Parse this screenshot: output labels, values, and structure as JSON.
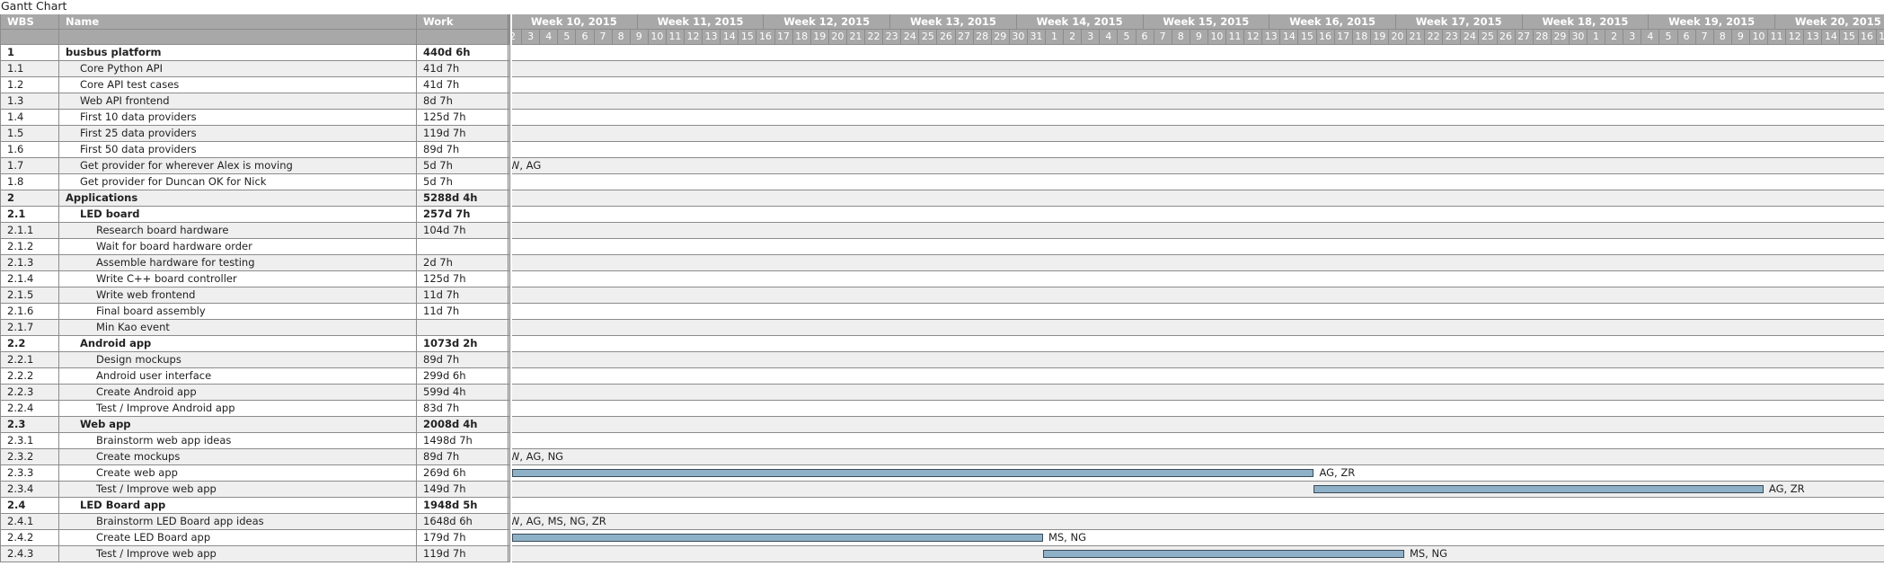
{
  "title": "Gantt Chart",
  "columns": {
    "wbs": "WBS",
    "name": "Name",
    "work": "Work"
  },
  "weeks": [
    "Week 10, 2015",
    "Week 11, 2015",
    "Week 12, 2015",
    "Week 13, 2015",
    "Week 14, 2015",
    "Week 15, 2015",
    "Week 16, 2015",
    "Week 17, 2015",
    "Week 18, 2015",
    "Week 19, 2015",
    "Week 20, 2015"
  ],
  "days": [
    "2",
    "3",
    "4",
    "5",
    "6",
    "7",
    "8",
    "9",
    "10",
    "11",
    "12",
    "13",
    "14",
    "15",
    "16",
    "17",
    "18",
    "19",
    "20",
    "21",
    "22",
    "23",
    "24",
    "25",
    "26",
    "27",
    "28",
    "29",
    "30",
    "31",
    "1",
    "2",
    "3",
    "4",
    "5",
    "6",
    "7",
    "8",
    "9",
    "10",
    "11",
    "12",
    "13",
    "14",
    "15",
    "16",
    "17",
    "18",
    "19",
    "20",
    "21",
    "22",
    "23",
    "24",
    "25",
    "26",
    "27",
    "28",
    "29",
    "30",
    "1",
    "2",
    "3",
    "4",
    "5",
    "6",
    "7",
    "8",
    "9",
    "10",
    "11",
    "12",
    "13",
    "14",
    "15",
    "16",
    "17"
  ],
  "colors": {
    "header": "#a8a8a8",
    "bar": "#8fb1c8",
    "bar_border": "#3b4b58",
    "alt_row": "#efefef"
  },
  "tasks": [
    {
      "wbs": "1",
      "name": "busbus platform",
      "work": "440d 6h",
      "level": 0,
      "bold": true
    },
    {
      "wbs": "1.1",
      "name": "Core Python API",
      "work": "41d 7h",
      "level": 1
    },
    {
      "wbs": "1.2",
      "name": "Core API test cases",
      "work": "41d 7h",
      "level": 1
    },
    {
      "wbs": "1.3",
      "name": "Web API frontend",
      "work": "8d 7h",
      "level": 1
    },
    {
      "wbs": "1.4",
      "name": "First 10 data providers",
      "work": "125d 7h",
      "level": 1
    },
    {
      "wbs": "1.5",
      "name": "First 25 data providers",
      "work": "119d 7h",
      "level": 1
    },
    {
      "wbs": "1.6",
      "name": "First 50 data providers",
      "work": "89d 7h",
      "level": 1
    },
    {
      "wbs": "1.7",
      "name": "Get provider for wherever Alex is moving",
      "work": "5d 7h",
      "level": 1,
      "resources": "W, AG"
    },
    {
      "wbs": "1.8",
      "name": "Get provider for Duncan OK for Nick",
      "work": "5d 7h",
      "level": 1
    },
    {
      "wbs": "2",
      "name": "Applications",
      "work": "5288d 4h",
      "level": 0,
      "bold": true
    },
    {
      "wbs": "2.1",
      "name": "LED board",
      "work": "257d 7h",
      "level": 1,
      "bold": true
    },
    {
      "wbs": "2.1.1",
      "name": "Research board hardware",
      "work": "104d 7h",
      "level": 2
    },
    {
      "wbs": "2.1.2",
      "name": "Wait for board hardware order",
      "work": "",
      "level": 2
    },
    {
      "wbs": "2.1.3",
      "name": "Assemble hardware for testing",
      "work": "2d 7h",
      "level": 2
    },
    {
      "wbs": "2.1.4",
      "name": "Write C++ board controller",
      "work": "125d 7h",
      "level": 2
    },
    {
      "wbs": "2.1.5",
      "name": "Write web frontend",
      "work": "11d 7h",
      "level": 2
    },
    {
      "wbs": "2.1.6",
      "name": "Final board assembly",
      "work": "11d 7h",
      "level": 2
    },
    {
      "wbs": "2.1.7",
      "name": "Min Kao event",
      "work": "",
      "level": 2
    },
    {
      "wbs": "2.2",
      "name": "Android app",
      "work": "1073d 2h",
      "level": 1,
      "bold": true
    },
    {
      "wbs": "2.2.1",
      "name": "Design mockups",
      "work": "89d 7h",
      "level": 2
    },
    {
      "wbs": "2.2.2",
      "name": "Android user interface",
      "work": "299d 6h",
      "level": 2
    },
    {
      "wbs": "2.2.3",
      "name": "Create Android app",
      "work": "599d 4h",
      "level": 2
    },
    {
      "wbs": "2.2.4",
      "name": "Test / Improve Android app",
      "work": "83d 7h",
      "level": 2
    },
    {
      "wbs": "2.3",
      "name": "Web app",
      "work": "2008d 4h",
      "level": 1,
      "bold": true
    },
    {
      "wbs": "2.3.1",
      "name": "Brainstorm web app ideas",
      "work": "1498d 7h",
      "level": 2
    },
    {
      "wbs": "2.3.2",
      "name": "Create mockups",
      "work": "89d 7h",
      "level": 2,
      "resources": "W, AG, NG"
    },
    {
      "wbs": "2.3.3",
      "name": "Create web app",
      "work": "269d 6h",
      "level": 2,
      "bar": [
        0,
        44.4
      ],
      "resources": "AG, ZR"
    },
    {
      "wbs": "2.3.4",
      "name": "Test / Improve web app",
      "work": "149d 7h",
      "level": 2,
      "bar": [
        44.4,
        69.3
      ],
      "resources": "AG, ZR"
    },
    {
      "wbs": "2.4",
      "name": "LED Board app",
      "work": "1948d 5h",
      "level": 1,
      "bold": true
    },
    {
      "wbs": "2.4.1",
      "name": "Brainstorm LED Board app ideas",
      "work": "1648d 6h",
      "level": 2,
      "resources": "W, AG, MS, NG, ZR"
    },
    {
      "wbs": "2.4.2",
      "name": "Create LED Board app",
      "work": "179d 7h",
      "level": 2,
      "bar": [
        0,
        29.4
      ],
      "resources": "MS, NG"
    },
    {
      "wbs": "2.4.3",
      "name": "Test / Improve web app",
      "work": "119d 7h",
      "level": 2,
      "bar": [
        29.4,
        49.4
      ],
      "resources": "MS, NG"
    }
  ]
}
